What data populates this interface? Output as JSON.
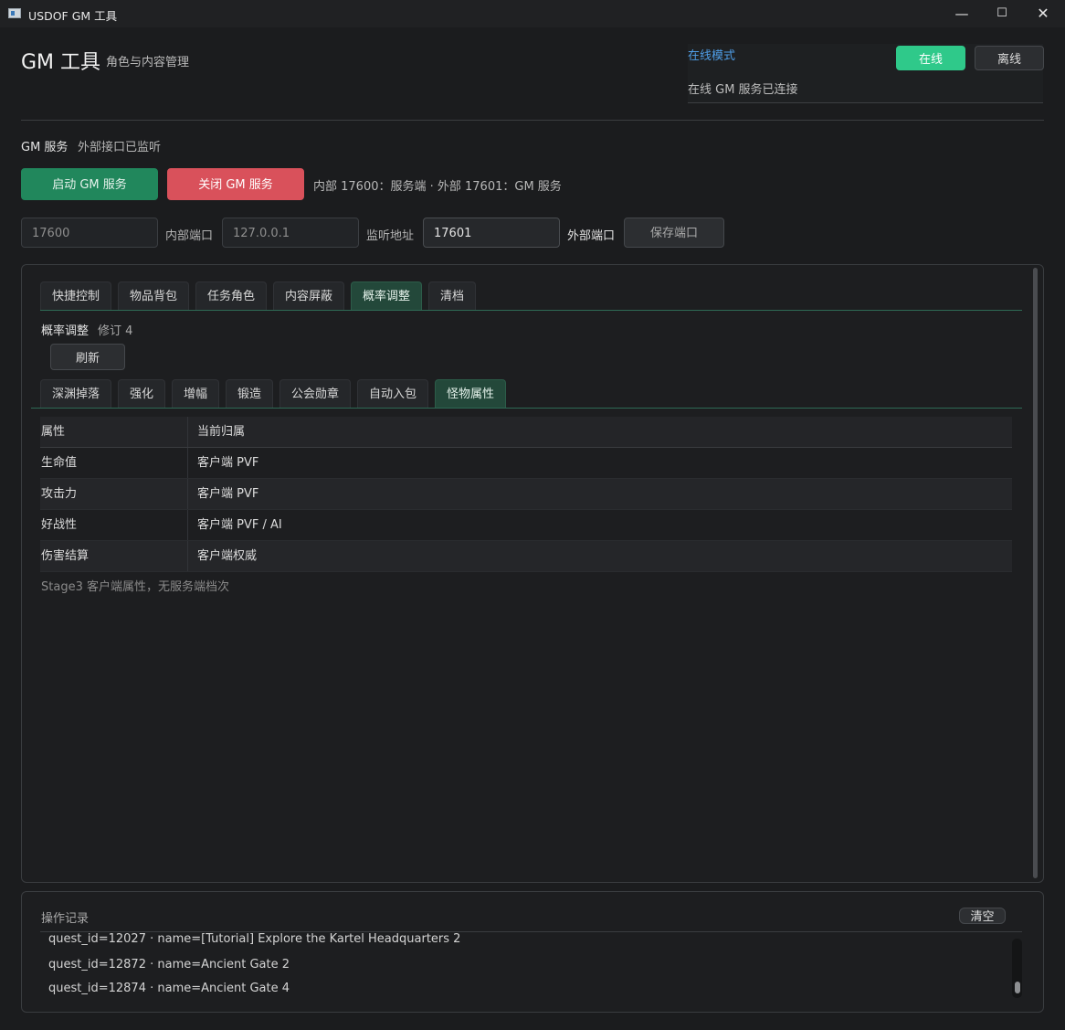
{
  "window": {
    "title": "USDOF GM 工具",
    "controls": {
      "minimize": "—",
      "maximize": "☐",
      "close": "✕"
    }
  },
  "header": {
    "title": "GM 工具",
    "subtitle": "角色与内容管理"
  },
  "mode": {
    "label": "在线模式",
    "status": "在线 GM 服务已连接",
    "online_label": "在线",
    "offline_label": "离线"
  },
  "gm_service": {
    "label": "GM 服务",
    "status": "外部接口已监听",
    "start_label": "启动 GM 服务",
    "stop_label": "关闭 GM 服务",
    "port_description": "内部 17600：服务端 · 外部 17601：GM 服务",
    "internal_port": "17600",
    "internal_port_label": "内部端口",
    "listen_address": "127.0.0.1",
    "listen_address_label": "监听地址",
    "external_port": "17601",
    "external_port_label": "外部端口",
    "save_label": "保存端口"
  },
  "tabs": [
    {
      "label": "快捷控制"
    },
    {
      "label": "物品背包"
    },
    {
      "label": "任务角色"
    },
    {
      "label": "内容屏蔽"
    },
    {
      "label": "概率调整",
      "active": true
    },
    {
      "label": "清档"
    }
  ],
  "section": {
    "title": "概率调整",
    "revision": "修订 4",
    "refresh_label": "刷新"
  },
  "subtabs": [
    {
      "label": "深渊掉落"
    },
    {
      "label": "强化"
    },
    {
      "label": "增幅"
    },
    {
      "label": "锻造"
    },
    {
      "label": "公会勋章"
    },
    {
      "label": "自动入包"
    },
    {
      "label": "怪物属性",
      "active": true
    }
  ],
  "table": {
    "headers": [
      "属性",
      "当前归属"
    ],
    "rows": [
      [
        "生命值",
        "客户端 PVF"
      ],
      [
        "攻击力",
        "客户端 PVF"
      ],
      [
        "好战性",
        "客户端 PVF / AI"
      ],
      [
        "伤害结算",
        "客户端权威"
      ]
    ],
    "note": "Stage3 客户端属性，无服务端档次"
  },
  "log": {
    "title": "操作记录",
    "clear_label": "清空",
    "lines": [
      "quest_id=12027 · name=[Tutorial] Explore the Kartel Headquarters 2",
      "quest_id=12872 · name=Ancient Gate 2",
      "quest_id=12874 · name=Ancient Gate 4"
    ]
  },
  "colors": {
    "accent_green": "#2fc98a",
    "start_button": "#21875c",
    "stop_button": "#d9515b",
    "link_blue": "#4f9ee8",
    "active_tab": "#23483a"
  }
}
